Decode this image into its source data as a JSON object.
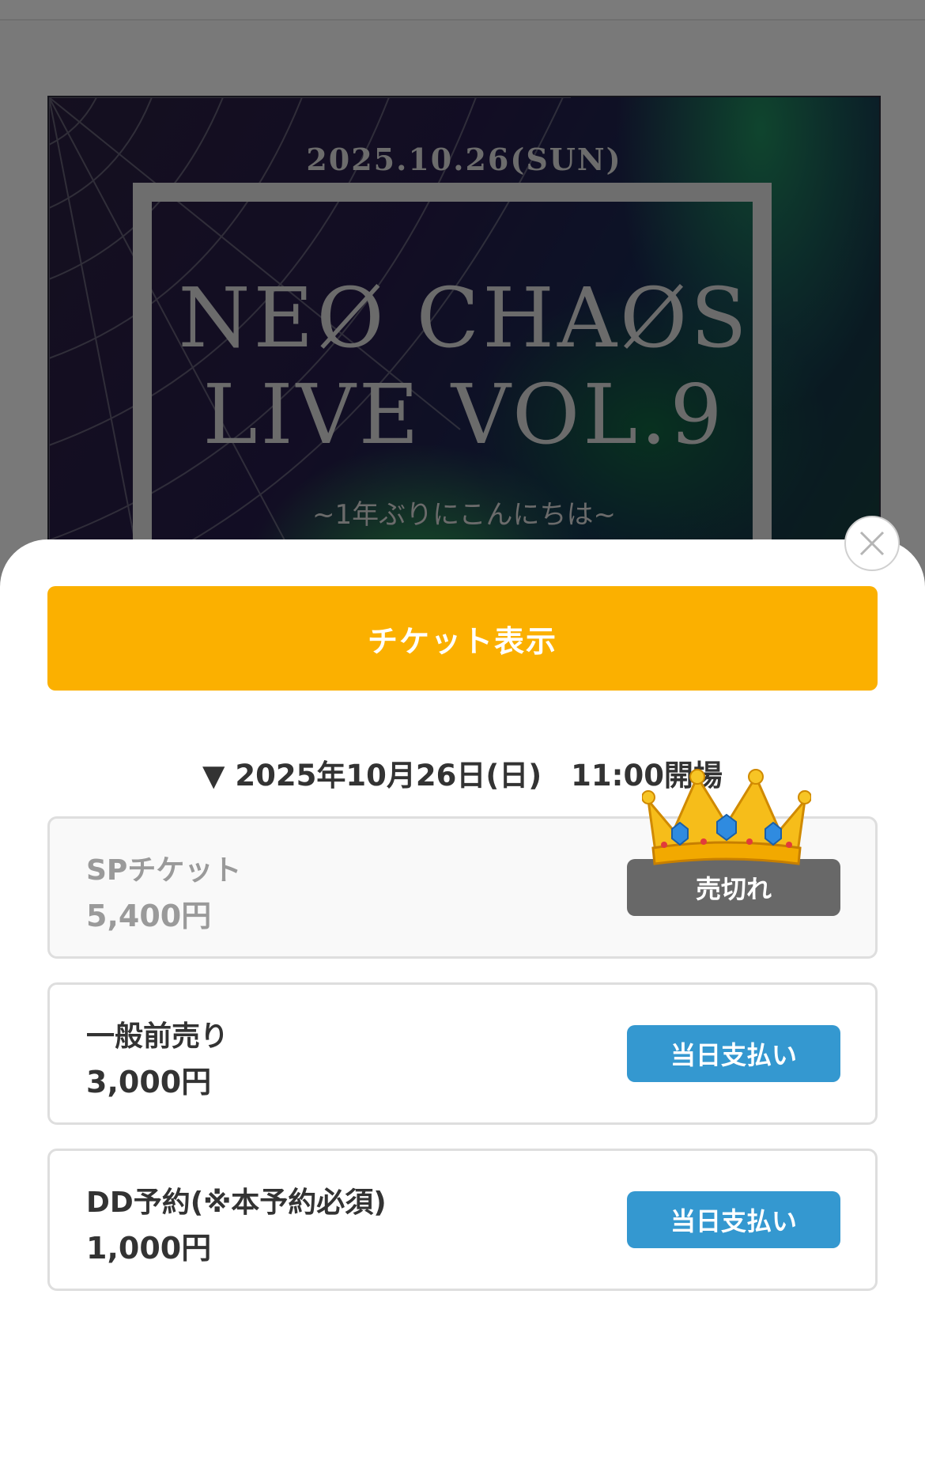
{
  "flyer": {
    "date": "2025.10.26(SUN)",
    "title_line1": "NEØ CHAØS",
    "title_line2": "LIVE VOL.9",
    "subtitle": "~1年ぶりにこんにちは~"
  },
  "sheet": {
    "close_icon": "close-icon",
    "ticket_button_label": "チケット表示",
    "date_heading": "▼ 2025年10月26日(日)　11:00開場",
    "tickets": [
      {
        "name": "SPチケット",
        "price": "5,400円",
        "action_label": "売切れ",
        "status": "sold-out",
        "badge_icon": "crown-icon"
      },
      {
        "name": "一般前売り",
        "price": "3,000円",
        "action_label": "当日支払い",
        "status": "available"
      },
      {
        "name": "DD予約(※本予約必須)",
        "price": "1,000円",
        "action_label": "当日支払い",
        "status": "available"
      }
    ]
  },
  "colors": {
    "ticket_button": "#fbb000",
    "pay_button": "#3498d0",
    "sold_out_button": "#686868",
    "text": "#333333"
  }
}
